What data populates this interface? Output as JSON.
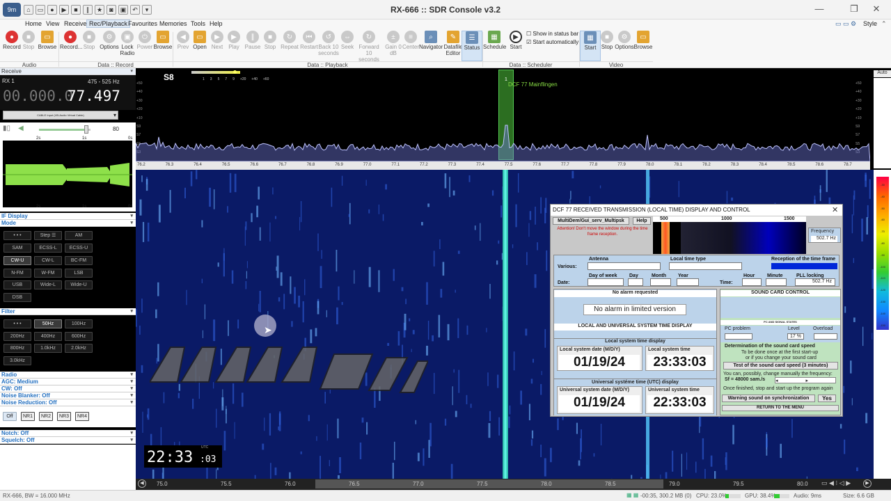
{
  "window": {
    "title": "RX-666 :: SDR Console v3.2",
    "style_label": "Style"
  },
  "menu": [
    "Home",
    "View",
    "Receive",
    "Rec/Playback",
    "Favourites",
    "Memories",
    "Tools",
    "Help"
  ],
  "ribbon": {
    "buttons": [
      "Record",
      "Stop",
      "Browse",
      "Record...",
      "Stop",
      "Options",
      "Lock Radio",
      "Power",
      "Browse",
      "Prev",
      "Open",
      "Next",
      "Play",
      "Pause",
      "Stop",
      "Repeat",
      "Restart",
      "Back 10 seconds",
      "Seek",
      "Forward 10 seconds",
      "Gain 0 dB",
      "Center",
      "Navigator",
      "Datafile Editor",
      "Status",
      "Schedule",
      "Start",
      "Start",
      "Stop",
      "Options",
      "Browse"
    ],
    "checks": [
      "Show in status bar",
      "Start automatically"
    ],
    "groups": [
      "Audio",
      "Data :: Record",
      "Data :: Playback",
      "Data :: Scheduler",
      "Video"
    ]
  },
  "left": {
    "receive_label": "Receive",
    "rx_label": "RX 1",
    "range": "475 - 525 Hz",
    "freq_dim": "00.000.0",
    "freq_bright": "77.497",
    "device": "CABLE Input (VB-Audio Virtual Cable)",
    "volume": "80",
    "scope_ticks": [
      "2s",
      "1s",
      "0s",
      "2s",
      "1s",
      "0s"
    ],
    "if_display": "IF Display",
    "mode": "Mode",
    "mode_buttons": [
      "• • •",
      "Step ☰",
      "AM",
      "SAM",
      "ECSS-L",
      "ECSS-U",
      "CW-U",
      "CW-L",
      "BC-FM",
      "N-FM",
      "W-FM",
      "LSB",
      "USB",
      "Wide-L",
      "Wide-U",
      "DSB"
    ],
    "filter": "Filter",
    "filter_buttons": [
      "• • •",
      "50Hz",
      "100Hz",
      "200Hz",
      "400Hz",
      "600Hz",
      "800Hz",
      "1.0kHz",
      "2.0kHz",
      "3.0kHz"
    ],
    "radio": [
      "Radio",
      "AGC: Medium",
      "CW: Off",
      "Noise Blanker: Off",
      "Noise Reduction: Off"
    ],
    "nr_buttons": [
      "Off",
      "NR1",
      "NR2",
      "NR3",
      "NR4"
    ],
    "notch": "Notch: Off",
    "squelch": "Squelch: Off"
  },
  "spectrum": {
    "s_meter": "S8",
    "smeter_scale": [
      "1",
      "3",
      "5",
      "7",
      "9",
      "+20",
      "+40",
      "+60"
    ],
    "db_left": [
      "+50",
      "+40",
      "+30",
      "+20",
      "+10",
      "S9",
      "S7",
      "S5",
      "S3"
    ],
    "db_right": [
      "+50",
      "+40",
      "+30",
      "+20",
      "+10",
      "S9",
      "S7",
      "S5",
      "S3"
    ],
    "auto": "Auto",
    "marker_label": "DCF 77 Mainflingen",
    "marker_num": "1",
    "freq_ticks": [
      "76.2",
      "76.3",
      "76.4",
      "76.5",
      "76.6",
      "76.7",
      "76.8",
      "76.9",
      "77.0",
      "77.1",
      "77.2",
      "77.3",
      "77.4",
      "77.5",
      "77.6",
      "77.7",
      "77.8",
      "77.9",
      "78.0",
      "78.1",
      "78.2",
      "78.3",
      "78.4",
      "78.5",
      "78.6",
      "78.7"
    ]
  },
  "waterfall": {
    "clock_main": "22:33",
    "clock_sec": ":03",
    "clock_tag": "UTC",
    "bottom_ticks": [
      "75.0",
      "75.5",
      "76.0",
      "76.5",
      "77.0",
      "77.5",
      "78.0",
      "78.5",
      "79.0",
      "79.5",
      "80.0"
    ],
    "colorbar_ticks": [
      "-30",
      "-40",
      "-50",
      "-60",
      "-70",
      "-80",
      "-90",
      "-100",
      "-110",
      "-120",
      "-130",
      "-140",
      "-150"
    ]
  },
  "dialog": {
    "title": "DCF 77 RECEIVED TRANSMISSION (LOCAL TIME) DISPLAY AND CONTROL",
    "multidem": "MultiDem/Gui_serv_Multipsk",
    "help": "Help",
    "attention": "Attention! Don't move the window during the time frame reception.",
    "scale": [
      "500",
      "1000",
      "1500"
    ],
    "frequency_label": "Frequency",
    "frequency_value": "502.7 Hz",
    "antenna": "Antenna",
    "local_time_type": "Local time type",
    "reception": "Reception of the time frame",
    "various": "Various:",
    "date": "Date:",
    "time": "Time:",
    "day_of_week": "Day of week",
    "day": "Day",
    "month": "Month",
    "year": "Year",
    "hour": "Hour",
    "minute": "Minute",
    "pll": "PLL locking",
    "pll_value": "502.7 Hz",
    "no_alarm": "No alarm requested",
    "no_alarm_limited": "No alarm in limited version",
    "local_universal": "LOCAL AND UNIVERSAL SYSTEM TIME DISPLAY",
    "local_display": "Local system time display",
    "local_date_label": "Local system date (M/D/Y)",
    "local_time_label": "Local system time",
    "local_date": "01/19/24",
    "local_time": "23:33:03",
    "utc_display": "Universal  systéme time (UTC) display",
    "utc_date_label": "Universal system date (M/D/Y)",
    "utc_time_label": "Universal system time",
    "utc_date": "01/19/24",
    "utc_time": "22:33:03",
    "sound_card": "SOUND CARD CONTROL",
    "pc_signal": "PC AND SIGNAL STATES",
    "pc_problem": "PC problem",
    "level": "Level",
    "level_value": "17 %",
    "overload": "Overload",
    "determination": "Determination of the sound card speed",
    "det_sub1": "To be done once at the first start-up",
    "det_sub2": "or if you change your sound card",
    "test_btn": "Test of the sound card speed (3 minutes)",
    "manual": "You can, possibly, change manually the frequency:",
    "sf": "Sf = 48000 sam./s",
    "once": "Once finished, stop and start up the program again",
    "warning": "Warning sound on synchronization",
    "yes": "Yes",
    "return": "RETURN TO THE MENU"
  },
  "statusbar": {
    "left": "RX-666, BW = 16.000 MHz",
    "time": "-00:35, 300.2 MB (0)",
    "cpu": "CPU: 23.0%",
    "gpu": "GPU: 38.4%",
    "audio": "Audio: 9ms",
    "size": "Size: 6.6 GB"
  }
}
